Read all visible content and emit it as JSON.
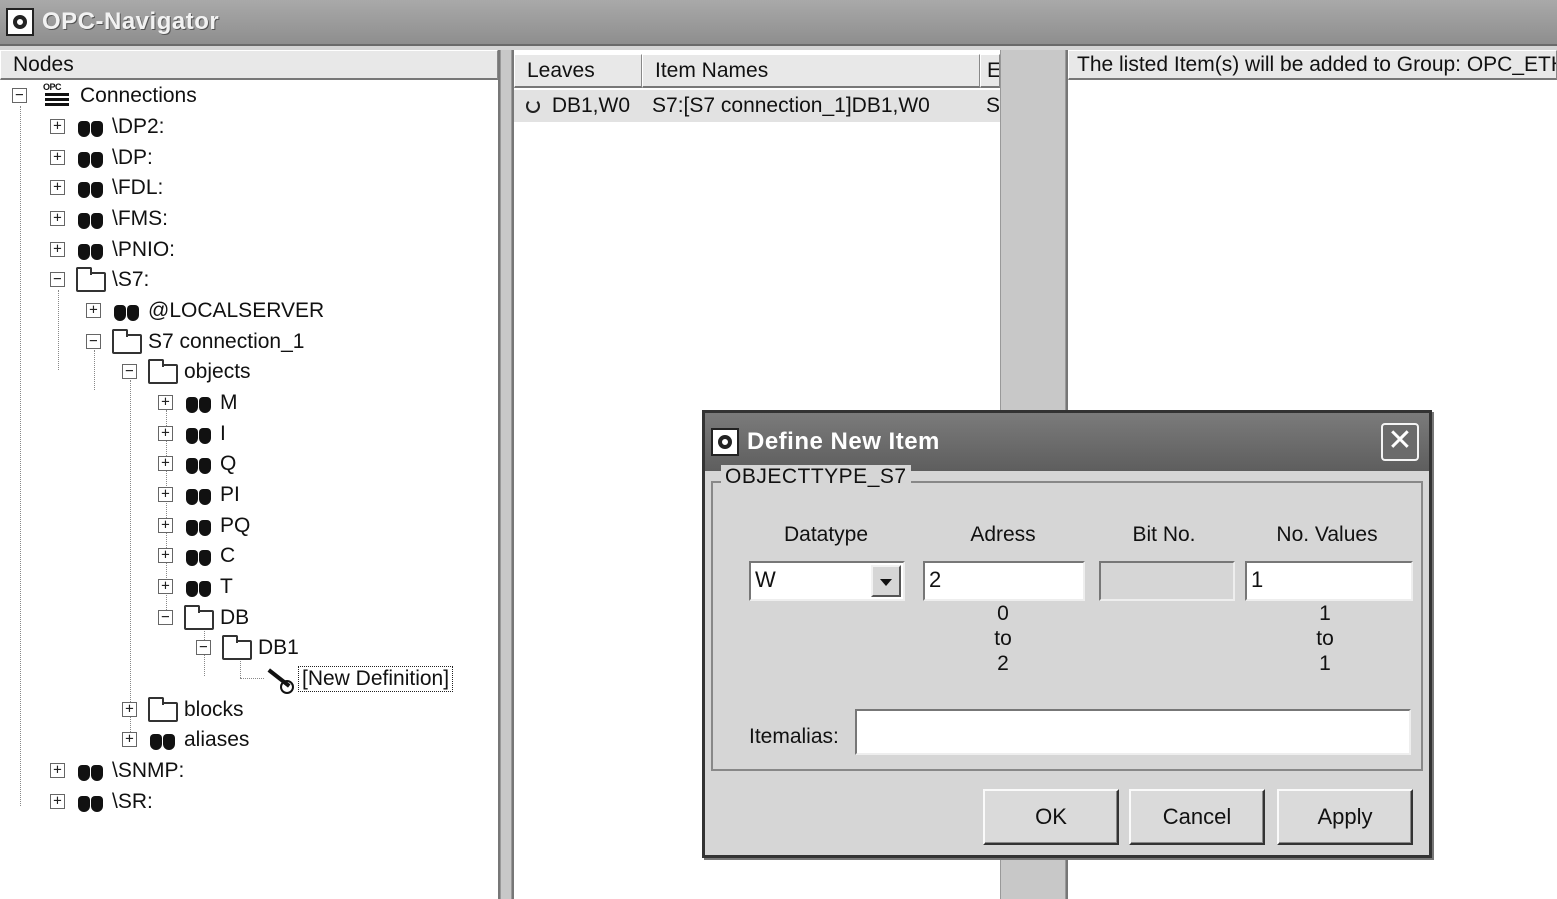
{
  "window": {
    "title": "OPC-Navigator",
    "icon": "opc-app-icon"
  },
  "nodes_pane": {
    "header": "Nodes",
    "tree": [
      {
        "label": "Connections",
        "icon": "connections-icon",
        "expander": "−"
      },
      {
        "label": "\\DP2:",
        "icon": "binoculars-icon",
        "expander": "+"
      },
      {
        "label": "\\DP:",
        "icon": "binoculars-icon",
        "expander": "+"
      },
      {
        "label": "\\FDL:",
        "icon": "binoculars-icon",
        "expander": "+"
      },
      {
        "label": "\\FMS:",
        "icon": "binoculars-icon",
        "expander": "+"
      },
      {
        "label": "\\PNIO:",
        "icon": "binoculars-icon",
        "expander": "+"
      },
      {
        "label": "\\S7:",
        "icon": "folder-icon",
        "expander": "−"
      },
      {
        "label": "@LOCALSERVER",
        "icon": "binoculars-icon",
        "expander": "+"
      },
      {
        "label": "S7 connection_1",
        "icon": "folder-icon",
        "expander": "−"
      },
      {
        "label": "objects",
        "icon": "folder-icon",
        "expander": "−"
      },
      {
        "label": "M",
        "icon": "binoculars-icon",
        "expander": "+"
      },
      {
        "label": "I",
        "icon": "binoculars-icon",
        "expander": "+"
      },
      {
        "label": "Q",
        "icon": "binoculars-icon",
        "expander": "+"
      },
      {
        "label": "PI",
        "icon": "binoculars-icon",
        "expander": "+"
      },
      {
        "label": "PQ",
        "icon": "binoculars-icon",
        "expander": "+"
      },
      {
        "label": "C",
        "icon": "binoculars-icon",
        "expander": "+"
      },
      {
        "label": "T",
        "icon": "binoculars-icon",
        "expander": "+"
      },
      {
        "label": "DB",
        "icon": "folder-icon",
        "expander": "−"
      },
      {
        "label": "DB1",
        "icon": "folder-icon",
        "expander": "−"
      },
      {
        "label": "[New Definition]",
        "icon": "magic-wand-icon",
        "expander": ""
      },
      {
        "label": "blocks",
        "icon": "folder-icon",
        "expander": "+"
      },
      {
        "label": "aliases",
        "icon": "binoculars-icon",
        "expander": "+"
      },
      {
        "label": "\\SNMP:",
        "icon": "binoculars-icon",
        "expander": "+"
      },
      {
        "label": "\\SR:",
        "icon": "binoculars-icon",
        "expander": "+"
      }
    ]
  },
  "leaves_pane": {
    "headers": [
      "Leaves",
      "Item Names",
      "E"
    ],
    "rows": [
      {
        "leaf": "DB1,W0",
        "item_name": "S7:[S7 connection_1]DB1,W0",
        "extra": "S"
      }
    ]
  },
  "right_pane": {
    "header": "The listed Item(s) will be added to Group: OPC_ETH"
  },
  "dialog": {
    "title": "Define New Item",
    "close_glyph": "✕",
    "group_label": "OBJECTTYPE_S7",
    "fields": {
      "datatype": {
        "label": "Datatype",
        "value": "W"
      },
      "adress": {
        "label": "Adress",
        "value": "2",
        "range_min": "0",
        "range_to": "to",
        "range_max": "2"
      },
      "bit_no": {
        "label": "Bit No.",
        "value": ""
      },
      "no_values": {
        "label": "No. Values",
        "value": "1",
        "range_min": "1",
        "range_to": "to",
        "range_max": "1"
      },
      "itemalias": {
        "label": "Itemalias:",
        "value": ""
      }
    },
    "buttons": {
      "ok": "OK",
      "cancel": "Cancel",
      "apply": "Apply"
    }
  }
}
